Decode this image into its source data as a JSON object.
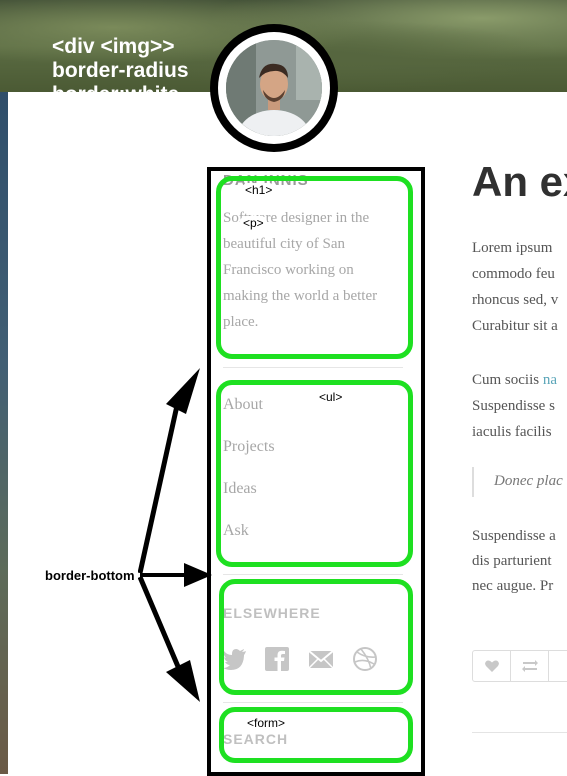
{
  "annotation": {
    "lines": [
      "<div <img>>",
      "border-radius",
      "border:white"
    ],
    "border_bottom_label": "border-bottom"
  },
  "tags": {
    "h1": "<h1>",
    "p": "<p>",
    "ul": "<ul>",
    "form": "<form>"
  },
  "sidebar": {
    "name": "DAN INNIS",
    "bio_lines": [
      "Software designer in the",
      "beautiful city of San",
      "Francisco working on",
      "making the world a better",
      "place."
    ],
    "nav": [
      "About",
      "Projects",
      "Ideas",
      "Ask"
    ],
    "elsewhere_heading": "ELSEWHERE",
    "social_icons": [
      "twitter-icon",
      "facebook-icon",
      "mail-icon",
      "dribbble-icon"
    ],
    "search_heading": "SEARCH"
  },
  "article": {
    "title": "An ex",
    "p1": [
      "Lorem ipsum",
      "commodo feu",
      "rhoncus sed, v",
      "Curabitur sit a"
    ],
    "p2_prefix": "Cum sociis ",
    "p2_link": "na",
    "p2_rest": [
      "Suspendisse s",
      "iaculis facilis"
    ],
    "quote": "Donec plac",
    "p3": [
      "Suspendisse a",
      "dis parturient",
      "nec augue. Pr"
    ]
  },
  "colors": {
    "highlight": "#1ee021",
    "frame": "#000000",
    "link": "#5aa5b8"
  }
}
